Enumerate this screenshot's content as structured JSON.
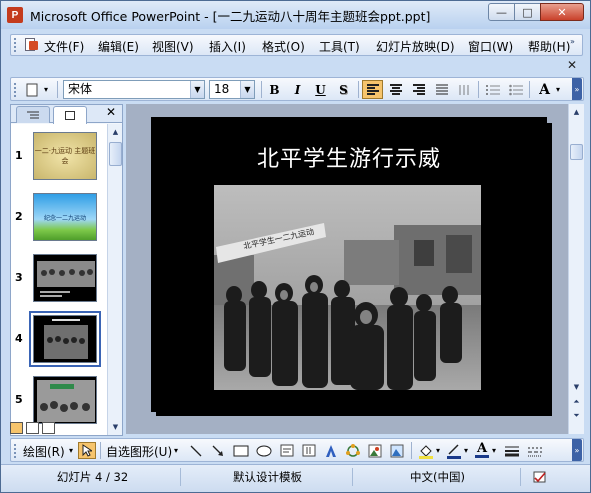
{
  "window": {
    "title": "Microsoft Office PowerPoint - [一二九运动八十周年主题班会ppt.ppt]",
    "app_icon_letter": "P",
    "min_glyph": "—",
    "max_glyph": "□",
    "close_glyph": "✕"
  },
  "menubar": {
    "items": [
      "文件(F)",
      "编辑(E)",
      "视图(V)",
      "插入(I)",
      "格式(O)",
      "工具(T)",
      "幻灯片放映(D)",
      "窗口(W)",
      "帮助(H)"
    ],
    "doc_close_glyph": "✕"
  },
  "toolbar": {
    "font_name": "宋体",
    "font_size": "18",
    "bold": "B",
    "italic": "I",
    "underline": "U",
    "shadow": "S",
    "font_grow": "A",
    "active_alignment": "left"
  },
  "left_pane": {
    "close_glyph": "✕",
    "slides": [
      {
        "number": "1",
        "theme": "parchment",
        "caption": "一二·九运动 主题班会"
      },
      {
        "number": "2",
        "theme": "sky-grass",
        "caption": "纪念一二九运动"
      },
      {
        "number": "3",
        "theme": "dark-photo",
        "caption": ""
      },
      {
        "number": "4",
        "theme": "dark-photo",
        "caption": "",
        "selected": true
      },
      {
        "number": "5",
        "theme": "dark-photo-banner",
        "caption": ""
      }
    ]
  },
  "slide": {
    "title": "北平学生游行示威",
    "photo_banner": "北平学生一二九运动"
  },
  "drawbar": {
    "draw_label": "绘图(R)",
    "autoshapes_label": "自选图形(U)",
    "font_color_letter": "A"
  },
  "statusbar": {
    "slide_info": "幻灯片 4 / 32",
    "template": "默认设计模板",
    "language": "中文(中国)"
  },
  "colors": {
    "title_bar": "#c9dcf3",
    "slide_bg": "#000000",
    "accent_active": "#f6c46c",
    "selected_outline": "#3a64b5"
  }
}
